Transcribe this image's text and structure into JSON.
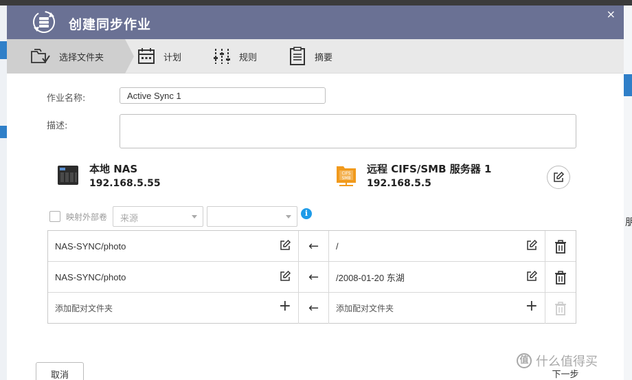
{
  "dialog": {
    "title": "创建同步作业",
    "close_glyph": "×"
  },
  "steps": [
    {
      "label": "选择文件夹",
      "icon": "folder-sync-icon",
      "active": true
    },
    {
      "label": "计划",
      "icon": "calendar-icon",
      "active": false
    },
    {
      "label": "规则",
      "icon": "sliders-icon",
      "active": false
    },
    {
      "label": "摘要",
      "icon": "clipboard-icon",
      "active": false
    }
  ],
  "form": {
    "job_name_label": "作业名称:",
    "job_name_value": "Active Sync 1",
    "description_label": "描述:",
    "description_value": ""
  },
  "local": {
    "name": "本地 NAS",
    "ip": "192.168.5.55"
  },
  "remote": {
    "name": "远程 CIFS/SMB 服务器 1",
    "ip": "192.168.5.5",
    "icon_text_top": "CIFS",
    "icon_text_bottom": "SMB"
  },
  "options": {
    "map_external_label": "映射外部卷",
    "source_select": "来源",
    "second_select": "",
    "info_glyph": "i"
  },
  "pairs": [
    {
      "local": "NAS-SYNC/photo",
      "arrow": "←",
      "remote": "/"
    },
    {
      "local": "NAS-SYNC/photo",
      "arrow": "←",
      "remote": "/2008-01-20 东湖"
    }
  ],
  "add_row": {
    "local": "添加配对文件夹",
    "arrow": "←",
    "remote": "添加配对文件夹",
    "plus": "+"
  },
  "buttons": {
    "cancel": "取消",
    "next": "下一步"
  },
  "background": {
    "right_glyph": "朋"
  },
  "watermark": {
    "badge": "值",
    "text": "什么值得买"
  }
}
